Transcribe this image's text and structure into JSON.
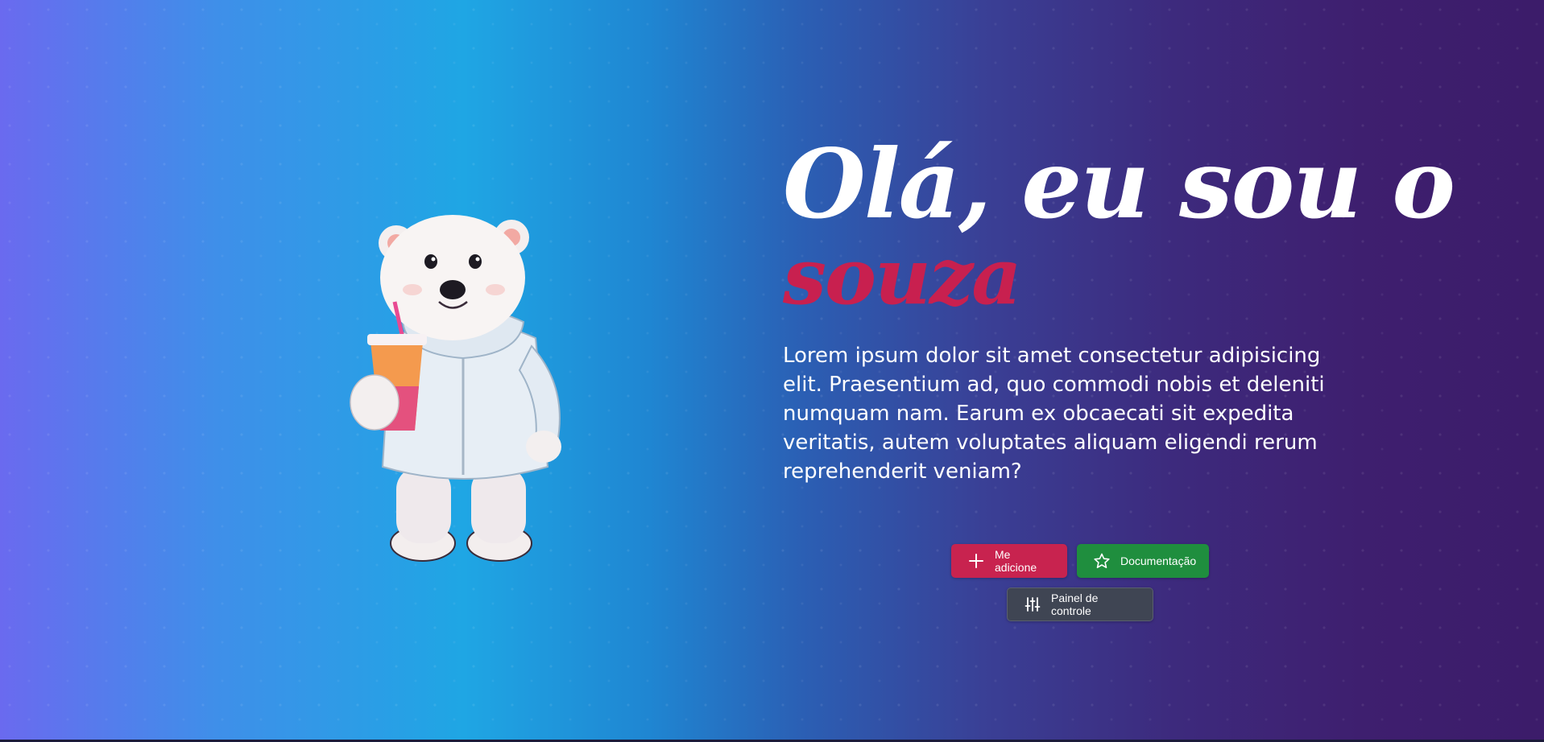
{
  "hero": {
    "greeting": "Olá, eu sou o",
    "name": "souza",
    "description": "Lorem ipsum dolor sit amet consectetur adipisicing elit. Praesentium ad, quo commodi nobis et deleniti numquam nam. Earum ex obcaecati sit expedita veritatis, autem voluptates aliquam eligendi rerum reprehenderit veniam?"
  },
  "buttons": {
    "add": {
      "label": "Me adicione",
      "icon": "plus-icon",
      "color": "#c8234f"
    },
    "docs": {
      "label": "Documentação",
      "icon": "star-icon",
      "color": "#1f8e3e"
    },
    "panel": {
      "label": "Painel de controle",
      "icon": "sliders-icon",
      "color": "#3f4553"
    }
  },
  "mascot": {
    "icon": "polar-bear-mascot"
  },
  "colors": {
    "accent": "#c8204f",
    "text": "#ffffff"
  }
}
